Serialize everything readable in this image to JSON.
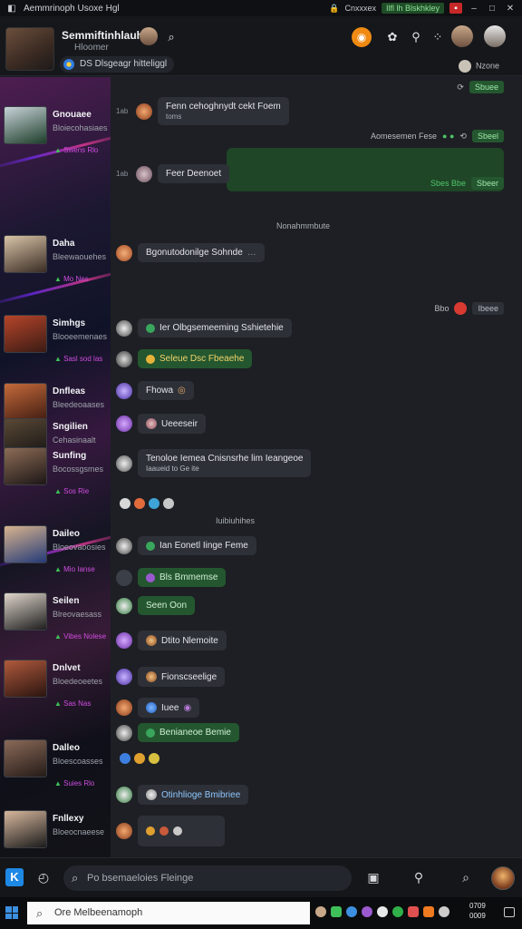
{
  "window": {
    "title": "Aemmrinoph Usoxe Hgl",
    "items": [
      "Cnxxxex",
      "Ilfl lh Blskhkley"
    ],
    "controls": [
      "–",
      "□",
      "✕"
    ]
  },
  "header": {
    "name": "Semmiftinhlauhan",
    "subtitle": "Hloomer",
    "chip": "DS Dlsgeagr hitteliggl",
    "right_label": "Nzone",
    "icons": [
      "search-icon",
      "flame-icon",
      "gear-icon",
      "pin-icon",
      "more-icon"
    ]
  },
  "sidebar": {
    "contacts": [
      {
        "name": "Gnouaee",
        "sub": "Bloiecohasiaes",
        "tags": "Swens Rlo",
        "color1": "#c8d2d8",
        "color2": "#1d3e2a"
      },
      {
        "name": "Daha",
        "sub": "Bleewaouehes",
        "tags": "Mo Nes",
        "color1": "#d9c4a8",
        "color2": "#3a2c24"
      },
      {
        "name": "Simhgs",
        "sub": "Blooeemenaes",
        "tags": "Sasl sod las",
        "color1": "#b6452a",
        "color2": "#3b1b14"
      },
      {
        "name": "Dnfleas",
        "sub": "Bleedeoaases",
        "tags": "",
        "color1": "#c46a3b",
        "color2": "#431d12"
      },
      {
        "name": "Sngilien",
        "sub": "Cehasinaalt",
        "tags": "",
        "color1": "#5a4936",
        "color2": "#161414"
      },
      {
        "name": "Sunfing",
        "sub": "Bocossgsmes",
        "tags": "Sos Rie",
        "color1": "#8d6c56",
        "color2": "#1c1616"
      },
      {
        "name": "Daileo",
        "sub": "Bloeovaoosies",
        "tags": "Mio Ianse",
        "color1": "#d9b48e",
        "color2": "#243a78"
      },
      {
        "name": "Seilen",
        "sub": "Blreovaesass",
        "tags": "Vibes Nolese",
        "color1": "#e0d6cc",
        "color2": "#1e1e1e"
      },
      {
        "name": "Dnlvet",
        "sub": "Bloedeoeetes",
        "tags": "Sas Nas",
        "color1": "#b05a3c",
        "color2": "#2a1410"
      },
      {
        "name": "Dalleo",
        "sub": "Bloescoasses",
        "tags": "Suies Rlo",
        "color1": "#8a6a58",
        "color2": "#251b18"
      },
      {
        "name": "Fnllexy",
        "sub": "Bloeocnaeese",
        "tags": "",
        "color1": "#d8b89e",
        "color2": "#1b1b1b"
      }
    ]
  },
  "chat": {
    "top_badge": "Sbuee",
    "messages": [
      {
        "text": "Fenn cehoghnydt cekt Foem",
        "sub": "toms",
        "style": "dark",
        "time": "1ab"
      },
      {
        "right_text": "Aomesemen Fese",
        "right_badge": "Sbeel",
        "style": "right"
      },
      {
        "text": "Feer Deenoet",
        "style": "dark",
        "time": "1ab"
      },
      {
        "right_badge2": "Sbeer",
        "right_small": "Sbes Bbe",
        "style": "right"
      },
      {
        "system": "Nonahmmbute"
      },
      {
        "text": "Bgonutodonilge Sohnde",
        "style": "dark"
      },
      {
        "right_badge3": "Ibeee",
        "right_small2": "Bbo"
      },
      {
        "text": "Ier Olbgsemeeming Sshietehie",
        "style": "dark"
      },
      {
        "text": "Seleue Dsc Fbeaehe",
        "style": "green"
      },
      {
        "text": "Fhowa",
        "style": "dark"
      },
      {
        "text": "Ueeeseir",
        "style": "dark"
      },
      {
        "text": "Tenoloe Iemea Cnisnsrhe lim Ieangeoe",
        "sub": "Iaaueid to Ge ite",
        "style": "dark"
      },
      {
        "system": "Iuibiuhihes"
      },
      {
        "text": "Ian Eonetl Iinge Feme",
        "style": "dark"
      },
      {
        "text": "Bls Bmmemse",
        "style": "green"
      },
      {
        "text": "Seen Oon",
        "style": "green"
      },
      {
        "text": "Dtito Nlemoite",
        "style": "dark"
      },
      {
        "text": "Fionscseelige",
        "style": "dark"
      },
      {
        "text": "Iuee",
        "style": "dark"
      },
      {
        "text": "Benianeoe Bemie",
        "style": "green"
      },
      {
        "text": "Otinhlioge Bmibriee",
        "style": "dark"
      }
    ]
  },
  "bottombar": {
    "search_placeholder": "Po bsemaeloies Fleinge"
  },
  "taskbar": {
    "search_placeholder": "Ore Melbeenamoph",
    "clock_time": "0709",
    "clock_date": "0009"
  },
  "colors": {
    "accent_green": "#24572f",
    "bubble_dark": "#2d3037",
    "orange": "#f08a12",
    "brand_blue": "#1e88e5"
  }
}
